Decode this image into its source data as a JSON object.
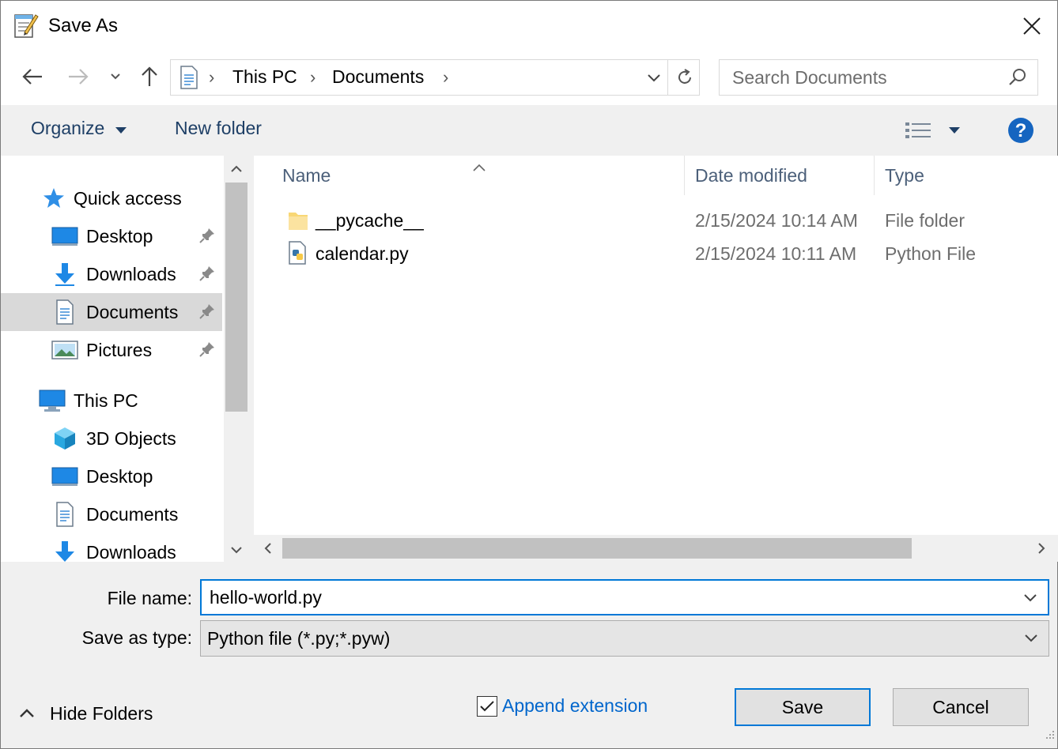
{
  "window": {
    "title": "Save As",
    "colors": {
      "accent": "#0078d7",
      "link": "#0066cc",
      "toolbar_text": "#1e3f66",
      "selected_row": "#d9d9d9"
    }
  },
  "address_bar": {
    "crumbs": [
      "This PC",
      "Documents"
    ],
    "search_placeholder": "Search Documents"
  },
  "toolbar": {
    "organize_label": "Organize",
    "new_folder_label": "New folder"
  },
  "nav_pane": {
    "quick_access": "Quick access",
    "qa_items": [
      {
        "label": "Desktop",
        "icon": "desktop-icon"
      },
      {
        "label": "Downloads",
        "icon": "download-icon"
      },
      {
        "label": "Documents",
        "icon": "document-icon",
        "selected": true
      },
      {
        "label": "Pictures",
        "icon": "pictures-icon"
      }
    ],
    "this_pc": "This PC",
    "pc_items": [
      {
        "label": "3D Objects",
        "icon": "cube-icon"
      },
      {
        "label": "Desktop",
        "icon": "desktop-icon"
      },
      {
        "label": "Documents",
        "icon": "document-icon"
      },
      {
        "label": "Downloads",
        "icon": "download-icon"
      }
    ]
  },
  "file_list": {
    "columns": [
      "Name",
      "Date modified",
      "Type"
    ],
    "rows": [
      {
        "name": "__pycache__",
        "date": "2/15/2024 10:14 AM",
        "type": "File folder",
        "icon": "folder-icon"
      },
      {
        "name": "calendar.py",
        "date": "2/15/2024 10:11 AM",
        "type": "Python File",
        "icon": "python-file-icon"
      }
    ]
  },
  "form": {
    "file_name_label": "File name:",
    "file_name_value": "hello-world.py",
    "save_type_label": "Save as type:",
    "save_type_value": "Python file (*.py;*.pyw)"
  },
  "footer": {
    "hide_folders_label": "Hide Folders",
    "append_extension_label": "Append extension",
    "append_extension_checked": true,
    "save_label": "Save",
    "cancel_label": "Cancel"
  }
}
